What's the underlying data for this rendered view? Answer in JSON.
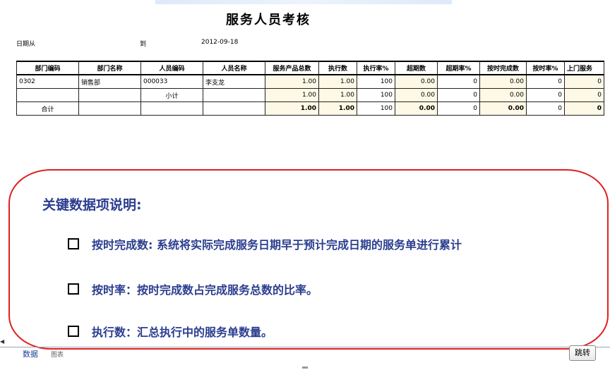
{
  "report": {
    "title": "服务人员考核",
    "date_from_label": "日期从",
    "date_to_label": "到",
    "date_to_value": "2012-09-18"
  },
  "table": {
    "headers": [
      "部门编码",
      "部门名称",
      "人员编码",
      "人员名称",
      "服务产品总数",
      "执行数",
      "执行率%",
      "超期数",
      "超期率%",
      "按时完成数",
      "按时率%",
      "上门服务"
    ],
    "rows": [
      {
        "dept_code": "0302",
        "dept_name": "销售部",
        "staff_code": "000033",
        "staff_name": "李支龙",
        "total": "1.00",
        "executed": "1.00",
        "exec_rate": "100",
        "overdue": "0.00",
        "overdue_rate": "0",
        "ontime": "0.00",
        "ontime_rate": "0",
        "onsite": "0"
      },
      {
        "subtotal_label": "小计",
        "total": "1.00",
        "executed": "1.00",
        "exec_rate": "100",
        "overdue": "0.00",
        "overdue_rate": "0",
        "ontime": "0.00",
        "ontime_rate": "0",
        "onsite": "0"
      },
      {
        "total_label": "合计",
        "total": "1.00",
        "executed": "1.00",
        "exec_rate": "100",
        "overdue": "0.00",
        "overdue_rate": "0",
        "ontime": "0.00",
        "ontime_rate": "0",
        "onsite": "0"
      }
    ]
  },
  "notes": {
    "heading": "关键数据项说明:",
    "items": [
      "按时完成数: 系统将实际完成服务日期早于预计完成日期的服务单进行累计",
      "按时率：按时完成数占完成服务总数的比率。",
      "执行数：汇总执行中的服务单数量。"
    ]
  },
  "footer": {
    "tab_data": "数据",
    "tab_chart": "图表",
    "jump_label": "跳转"
  },
  "colors": {
    "note_border": "#e02020",
    "note_text": "#2b3d8f",
    "highlight_cell": "#fdf9e6",
    "tab_active": "#1f3f9b"
  }
}
